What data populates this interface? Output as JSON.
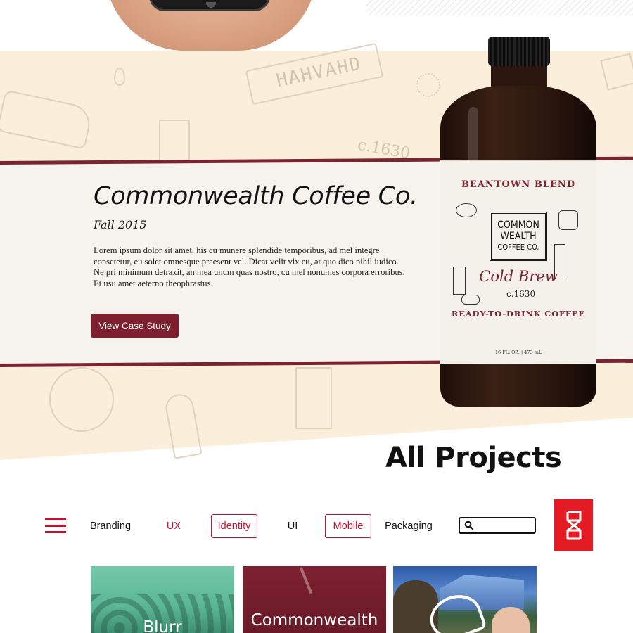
{
  "feature": {
    "title": "Commonwealth Coffee Co.",
    "date": "Fall 2015",
    "body": "Lorem ipsum dolor sit amet, his cu munere splendide temporibus, ad mel integre consetetur, eu solet omnesque praesent vel. Dicat velit vix eu, at quo dico nihil iudico. Ne pri minimum detraxit, an mea unum quas nostro, cu mel nonumes corpora erroribus. Et usu amet aeterno theophrastus.",
    "button_label": "View Case Study",
    "background_text": {
      "sign": "HAHVAHD",
      "year": "c.1630"
    }
  },
  "bottle_label": {
    "top_arc": "BEANTOWN BLEND",
    "brand_lines": [
      "COMMON",
      "WEALTH",
      "COFFEE CO."
    ],
    "product": "Cold Brew",
    "year": "c.1630",
    "bottom_arc": "READY-TO-DRINK COFFEE",
    "volume": "16 FL. OZ. | 473 mL"
  },
  "projects": {
    "title": "All Projects",
    "filters": [
      {
        "label": "Branding",
        "state": "plain"
      },
      {
        "label": "UX",
        "state": "active"
      },
      {
        "label": "Identity",
        "state": "boxed"
      },
      {
        "label": "UI",
        "state": "plain"
      },
      {
        "label": "Mobile",
        "state": "boxed"
      },
      {
        "label": "Packaging",
        "state": "plain"
      }
    ],
    "search": {
      "value": "",
      "placeholder": ""
    },
    "cards": [
      {
        "title": "Blurr"
      },
      {
        "title": "Commonwealth"
      },
      {
        "title": ""
      }
    ]
  },
  "colors": {
    "accent": "#c8102e",
    "maroon": "#7d1f2e",
    "cream": "#fbefdb",
    "logo_red": "#e31b23"
  },
  "icons": {
    "menu": "hamburger-icon",
    "search": "search-icon",
    "logo": "brand-logo-icon"
  }
}
